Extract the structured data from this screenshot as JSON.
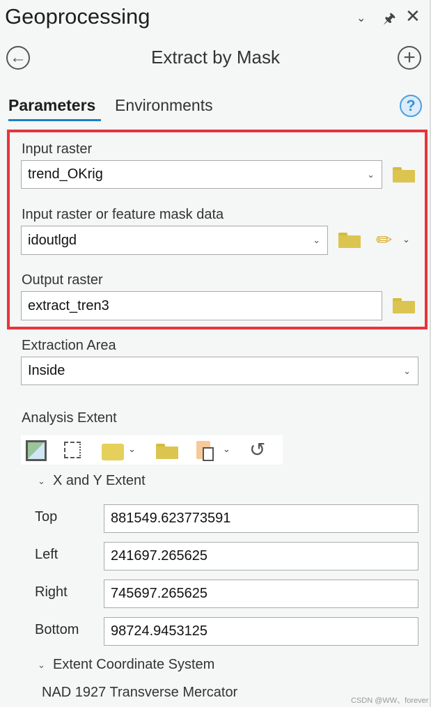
{
  "pane": {
    "title": "Geoprocessing",
    "tool_title": "Extract by Mask"
  },
  "tabs": [
    {
      "label": "Parameters",
      "active": true
    },
    {
      "label": "Environments",
      "active": false
    }
  ],
  "params": {
    "input_raster": {
      "label": "Input raster",
      "value": "trend_OKrig"
    },
    "mask": {
      "label": "Input raster or feature mask data",
      "value": "idoutlgd"
    },
    "output_raster": {
      "label": "Output raster",
      "value": "extract_tren3"
    },
    "extraction_area": {
      "label": "Extraction Area",
      "value": "Inside"
    },
    "analysis_extent": {
      "label": "Analysis Extent"
    }
  },
  "extent": {
    "section_label": "X and Y Extent",
    "rows": [
      {
        "label": "Top",
        "value": "881549.623773591"
      },
      {
        "label": "Left",
        "value": "241697.265625"
      },
      {
        "label": "Right",
        "value": "745697.265625"
      },
      {
        "label": "Bottom",
        "value": "98724.9453125"
      }
    ],
    "coord_section_label": "Extent Coordinate System",
    "coord_system": "NAD 1927 Transverse Mercator"
  },
  "watermark": "CSDN @WW、forever",
  "colors": {
    "highlight": "#e8343a",
    "accent": "#1a7fc8",
    "folder": "#dcc450"
  }
}
